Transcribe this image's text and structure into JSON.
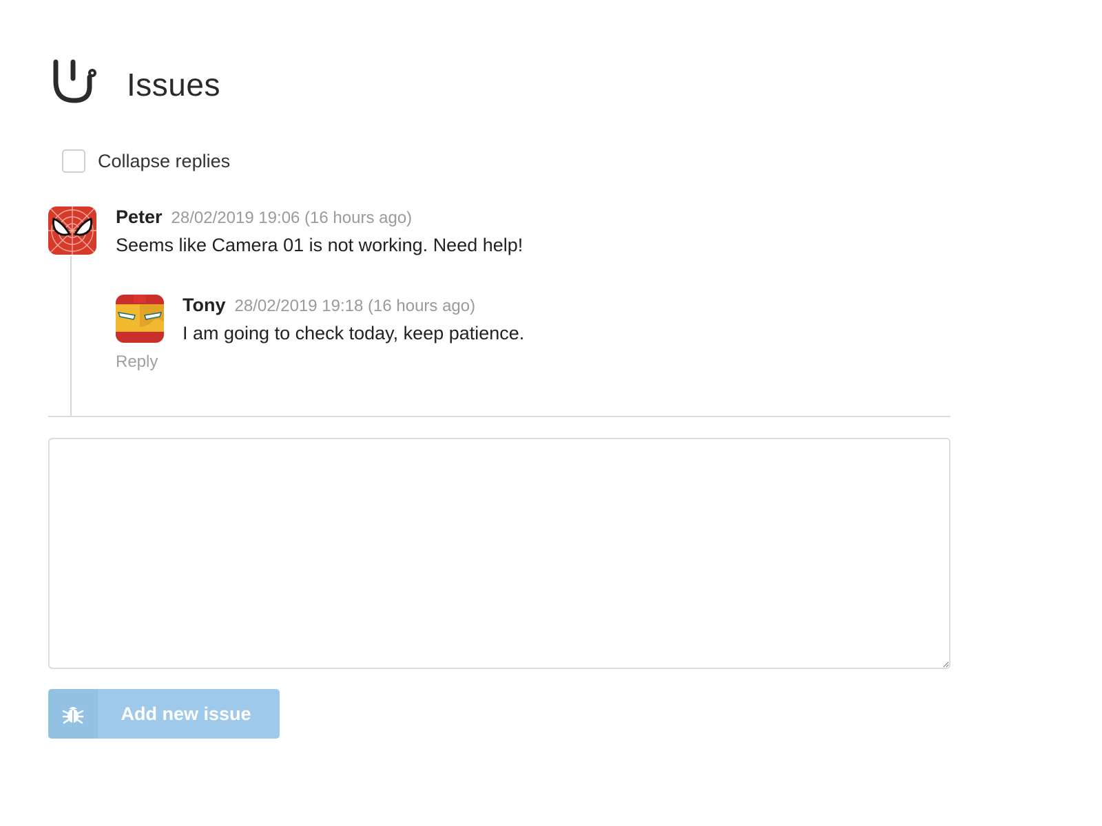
{
  "header": {
    "title": "Issues",
    "icon": "stethoscope-icon"
  },
  "collapse": {
    "label": "Collapse replies",
    "checked": false
  },
  "comments": [
    {
      "author": "Peter",
      "timestamp": "28/02/2019 19:06 (16 hours ago)",
      "text": "Seems like Camera 01 is not working. Need help!",
      "avatar": "spiderman-avatar",
      "replies": [
        {
          "author": "Tony",
          "timestamp": "28/02/2019 19:18 (16 hours ago)",
          "text": "I am going to check today, keep patience.",
          "avatar": "ironman-avatar"
        }
      ],
      "reply_label": "Reply"
    }
  ],
  "composer": {
    "placeholder": "",
    "value": ""
  },
  "submit": {
    "label": "Add new issue",
    "icon": "bug-icon"
  },
  "colors": {
    "button_bg": "#9ec9ea",
    "button_icon_bg": "#93c1e4",
    "muted_text": "#9a9a9a",
    "spiderman_red": "#d63a2a",
    "ironman_gold": "#f2b830"
  }
}
